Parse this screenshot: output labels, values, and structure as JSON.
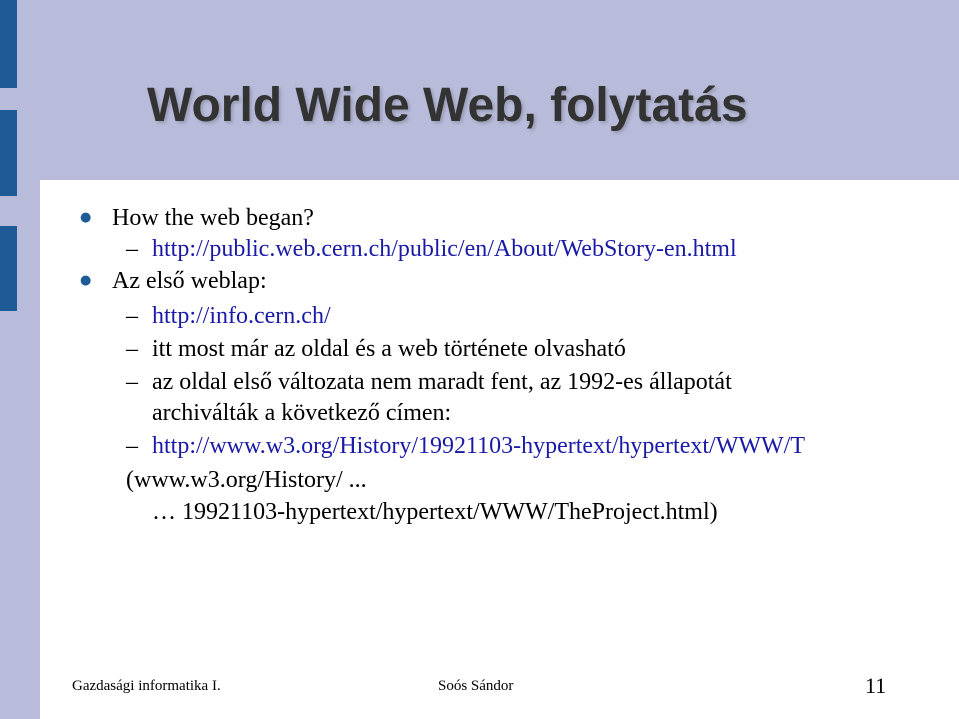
{
  "title": "World Wide Web, folytatás",
  "items": {
    "b1": "How the web began?",
    "b1_sub1": "http://public.web.cern.ch/public/en/About/WebStory-en.html",
    "b2": "Az első weblap:",
    "b2_sub1": "http://info.cern.ch/",
    "b2_sub2": "itt most már az oldal és a web története olvasható",
    "b2_sub3_l1": "az oldal első változata nem maradt fent, az 1992-es állapotát",
    "b2_sub3_l2": "archiválták a következő címen:",
    "b2_sub4": "http://www.w3.org/History/19921103-hypertext/hypertext/WWW/T",
    "wrap_l1": "(www.w3.org/History/ ...",
    "wrap_l2": "… 19921103-hypertext/hypertext/WWW/TheProject.html)"
  },
  "footer": {
    "course": "Gazdasági informatika I.",
    "author": "Soós Sándor",
    "page": "11"
  },
  "colors": {
    "background": "#b8bcda",
    "accent_bar": "#1e5a96",
    "link": "#1a1aa8",
    "content_bg": "#ffffff"
  }
}
